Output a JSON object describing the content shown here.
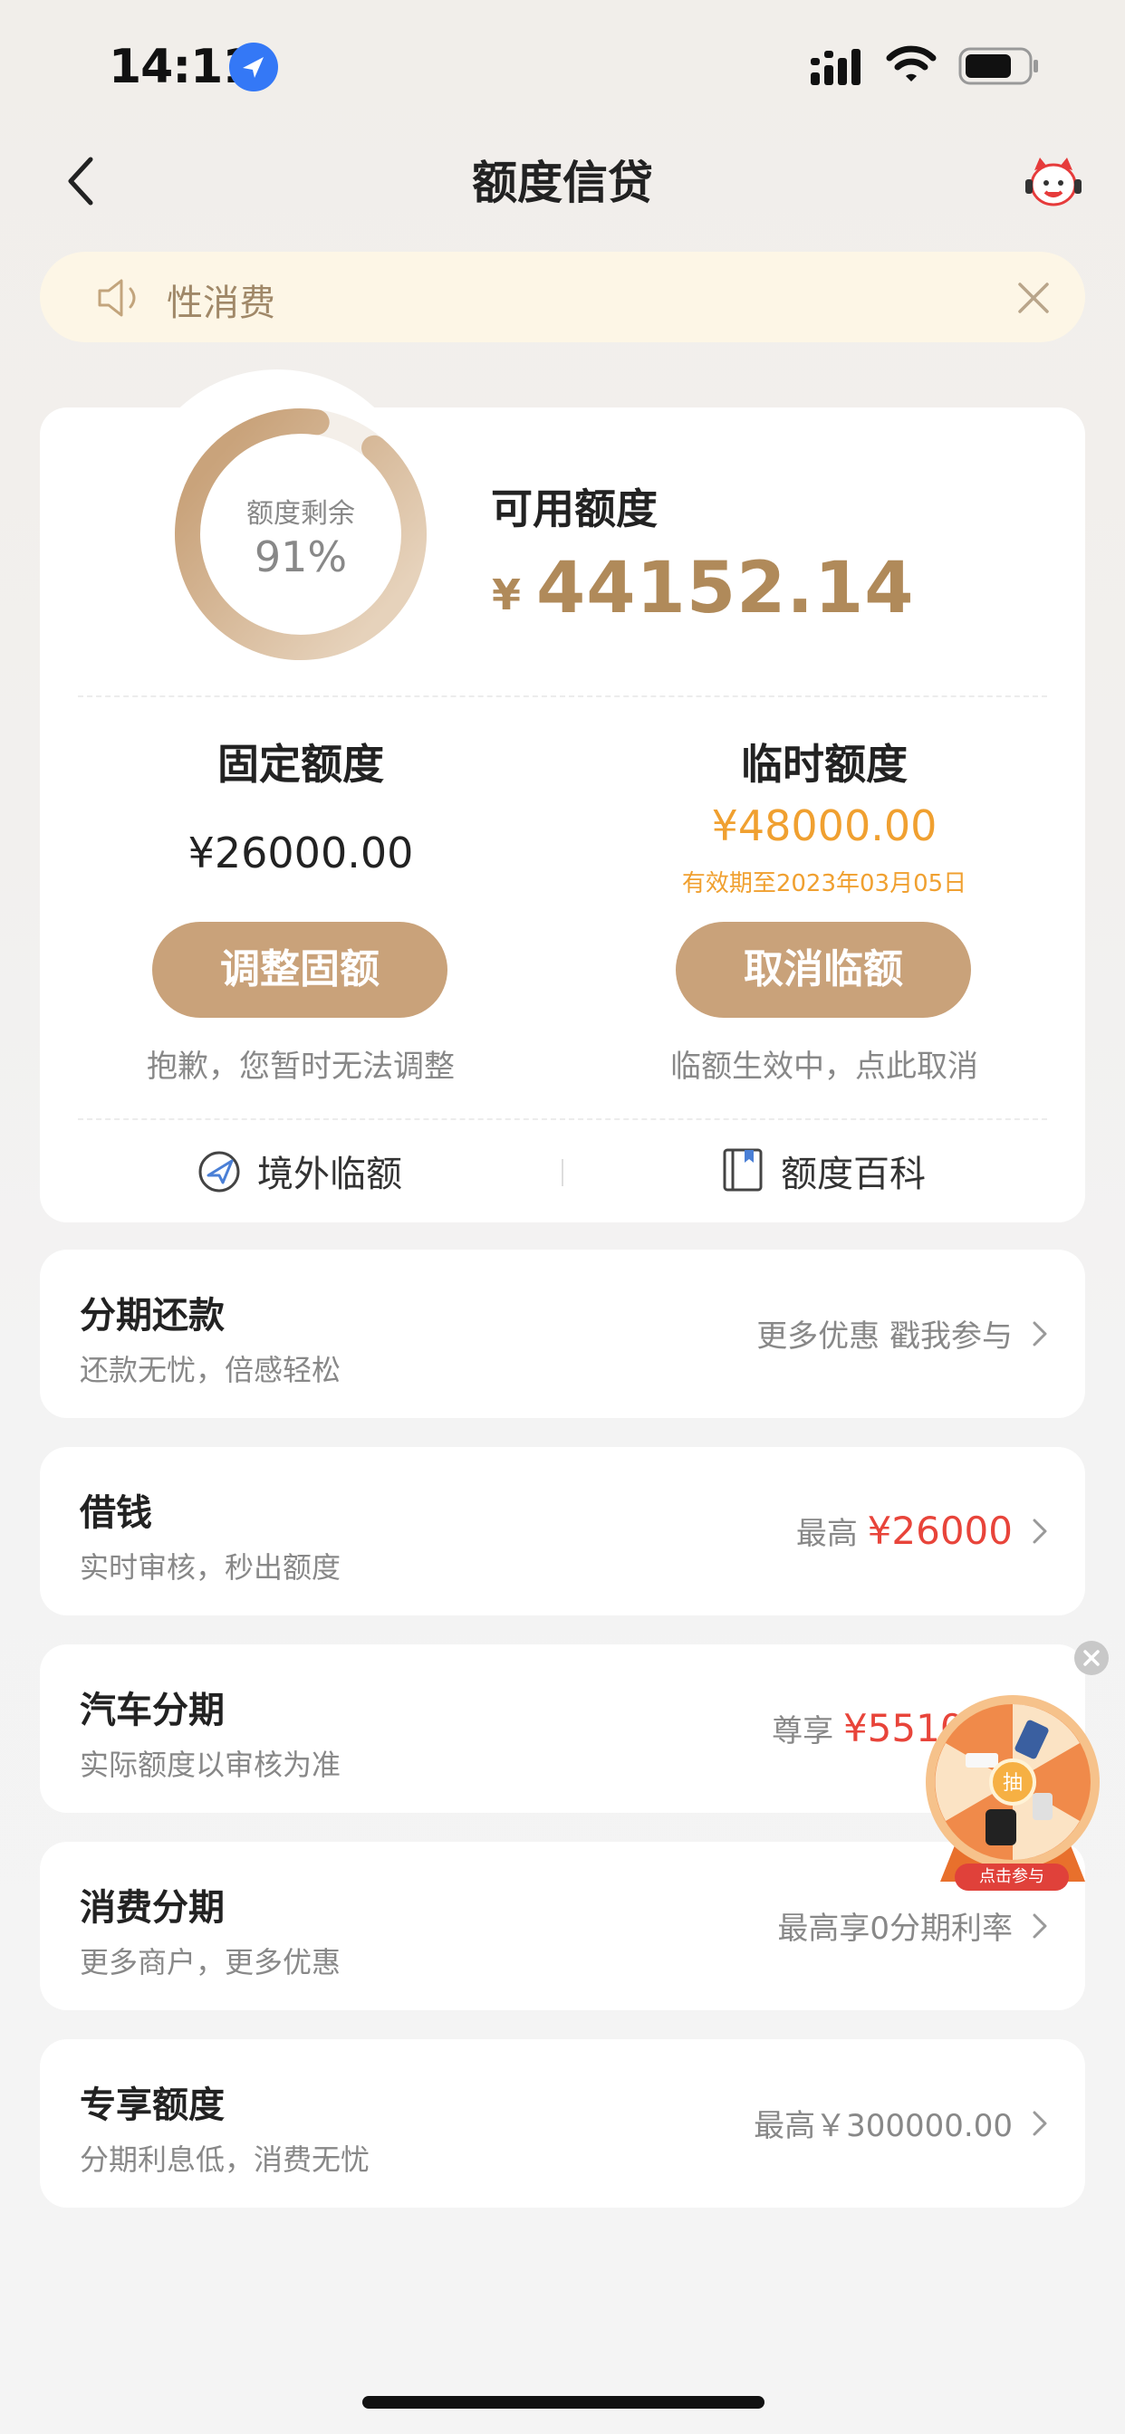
{
  "status_bar": {
    "time": "14:11"
  },
  "nav": {
    "title": "额度信贷"
  },
  "notice": {
    "text": "性消费"
  },
  "credit": {
    "ring_label": "额度剩余",
    "ring_percent": "91%",
    "remaining_fraction": 0.91,
    "available_title": "可用额度",
    "available_symbol": "¥",
    "available_value": "44152.14",
    "fixed": {
      "title": "固定额度",
      "amount": "¥26000.00",
      "button": "调整固额",
      "hint": "抱歉，您暂时无法调整"
    },
    "temporary": {
      "title": "临时额度",
      "amount": "¥48000.00",
      "expiry": "有效期至2023年03月05日",
      "button": "取消临额",
      "hint": "临额生效中，点此取消"
    },
    "links": {
      "overseas": "境外临额",
      "encyclopedia": "额度百科"
    }
  },
  "list": [
    {
      "title": "分期还款",
      "subtitle": "还款无忧，倍感轻松",
      "right_prefix": "更多优惠 戳我参与",
      "right_value": ""
    },
    {
      "title": "借钱",
      "subtitle": "实时审核，秒出额度",
      "right_prefix": "最高 ",
      "right_value": "¥26000"
    },
    {
      "title": "汽车分期",
      "subtitle": "实际额度以审核为准",
      "right_prefix": "尊享 ",
      "right_value": "¥551000"
    },
    {
      "title": "消费分期",
      "subtitle": "更多商户，更多优惠",
      "right_prefix": "最高享0分期利率",
      "right_value": ""
    },
    {
      "title": "专享额度",
      "subtitle": "分期利息低，消费无忧",
      "right_prefix": "最高￥300000.00",
      "right_value": ""
    }
  ],
  "float_widget": {
    "center_text": "抽",
    "label": "点击参与"
  },
  "colors": {
    "gold": "#c9a27a",
    "amount_gold": "#b08a5a",
    "orange": "#f0a030",
    "red": "#e8443a"
  }
}
